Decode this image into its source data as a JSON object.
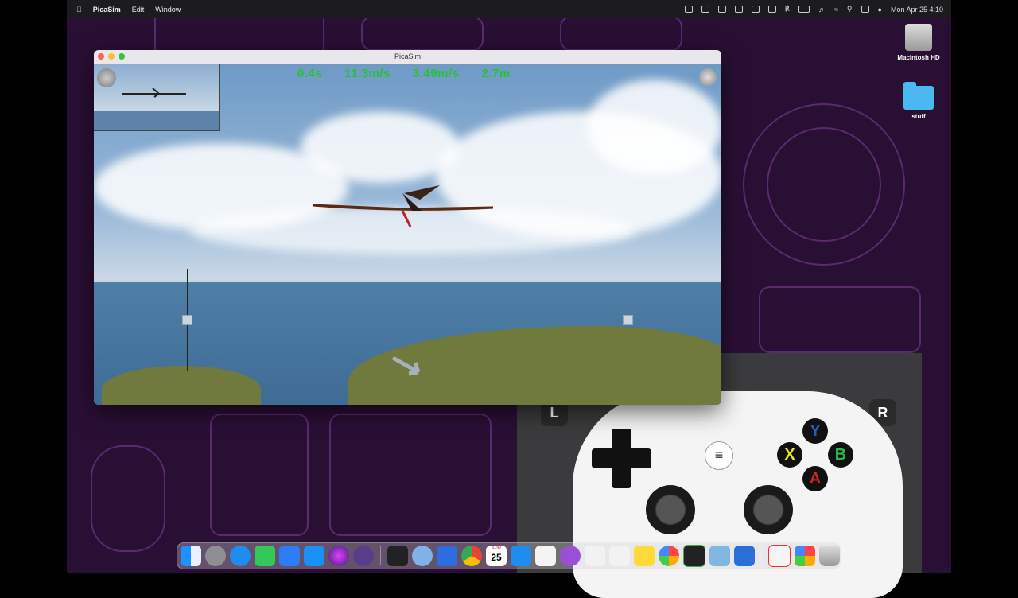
{
  "menubar": {
    "app_name": "PicaSim",
    "menus": [
      "Edit",
      "Window"
    ],
    "clock": "Mon Apr 25  4:10"
  },
  "desktop": {
    "icons": [
      {
        "label": "Macintosh HD",
        "icon": "hard-drive-icon"
      },
      {
        "label": "stuff",
        "icon": "folder-icon"
      }
    ]
  },
  "window": {
    "title": "PicaSim",
    "hud": {
      "time": "0.4s",
      "airspeed": "11.3m/s",
      "vertical_speed": "3.49m/s",
      "altitude": "2.7m"
    }
  },
  "gamepad": {
    "left_shoulder": "L",
    "right_shoulder": "R",
    "buttons": {
      "y": "Y",
      "x": "X",
      "b": "B",
      "a": "A"
    },
    "colors": {
      "y": "#1f5fc8",
      "x": "#e6e61a",
      "b": "#2fb84a",
      "a": "#d8202a"
    }
  },
  "dock": {
    "calendar_month": "APR",
    "calendar_day": "25",
    "apps": [
      "finder-icon",
      "system-preferences-icon",
      "safari-icon",
      "messages-icon",
      "mail-icon",
      "app-store-icon",
      "siri-icon",
      "quicktime-icon",
      "terminal-icon",
      "quicklook-icon",
      "xcode-icon",
      "chrome-icon",
      "calendar-icon",
      "weather-icon",
      "slack-icon",
      "podcasts-icon",
      "textedit-icon",
      "pixelmator-icon",
      "notes-icon",
      "photos-icon",
      "activity-monitor-icon",
      "picasim-icon",
      "game-controller-icon",
      "music-icon",
      "photos-library-icon",
      "trash-icon"
    ]
  }
}
